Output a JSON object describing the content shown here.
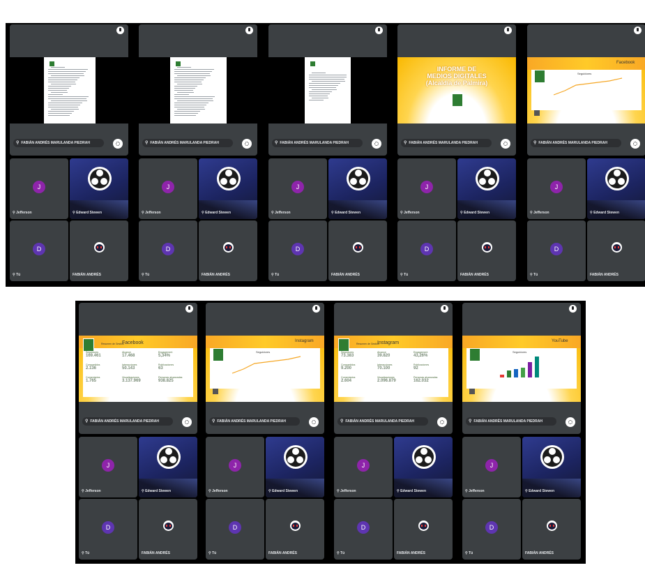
{
  "participants": {
    "presenter_full": "FABIÁN ANDRÉS MARULANDA PIEDRAH",
    "presenter_short": "FABIÁN ANDRÉS",
    "jefferson": "Jefferson",
    "jefferson_initial": "J",
    "edward": "Edward Stewen",
    "you": "Tú",
    "you_initial": "D"
  },
  "colors": {
    "tile": "#3c4043",
    "frame": "#000000",
    "avatar_j": "#8e24aa",
    "avatar_d": "#5e35b1",
    "slide_yellow": "#f9b800"
  },
  "icons": [
    "pin-icon",
    "mic-off-icon",
    "expand-icon",
    "obs-logo-icon",
    "user-avatar-icon"
  ],
  "slides": {
    "intro_title_1": "INFORME DE",
    "intro_title_2": "MEDIOS DIGITALES",
    "intro_title_3": "(Alcaldía de Palmira)",
    "fb_label": "Facebook",
    "ig_label": "Instagram",
    "yt_label": "YouTube",
    "fb_header_prefix": "Resumen de Gestión",
    "ig_header_prefix": "Resumen de Gestión",
    "chart_title": "Seguidores",
    "fb": {
      "seguidores_l": "Seguidores",
      "seguidores_v": "169.461",
      "alcance_l": "Alcance",
      "alcance_v": "17.468",
      "engagement_l": "Engagement",
      "engagement_v": "5,34%",
      "compartidos_l": "Compartidos",
      "compartidos_v": "2.136",
      "interacciones_l": "Interacciones",
      "interacciones_v": "50.143",
      "publicaciones_l": "Publicaciones",
      "publicaciones_v": "63",
      "comentarios_l": "Comentarios",
      "comentarios_v": "1.765",
      "visualizaciones_l": "Visualizaciones",
      "visualizaciones_v": "3.137.969",
      "personas_l": "Personas alcanzadas",
      "personas_v": "938.825"
    },
    "ig": {
      "seguidores_l": "Seguidores",
      "seguidores_v": "73.383",
      "alcance_l": "Alcance",
      "alcance_v": "39.820",
      "engagement_l": "Engagement",
      "engagement_v": "43,26%",
      "compartidos_l": "Compartidos",
      "compartidos_v": "9.200",
      "interacciones_l": "Interacciones",
      "interacciones_v": "70.100",
      "publicaciones_l": "Publicaciones",
      "publicaciones_v": "92",
      "comentarios_l": "Comentarios",
      "comentarios_v": "2.604",
      "visualizaciones_l": "Visualizaciones",
      "visualizaciones_v": "2.096.879",
      "personas_l": "Personas alcanzadas",
      "personas_v": "162.032"
    }
  }
}
